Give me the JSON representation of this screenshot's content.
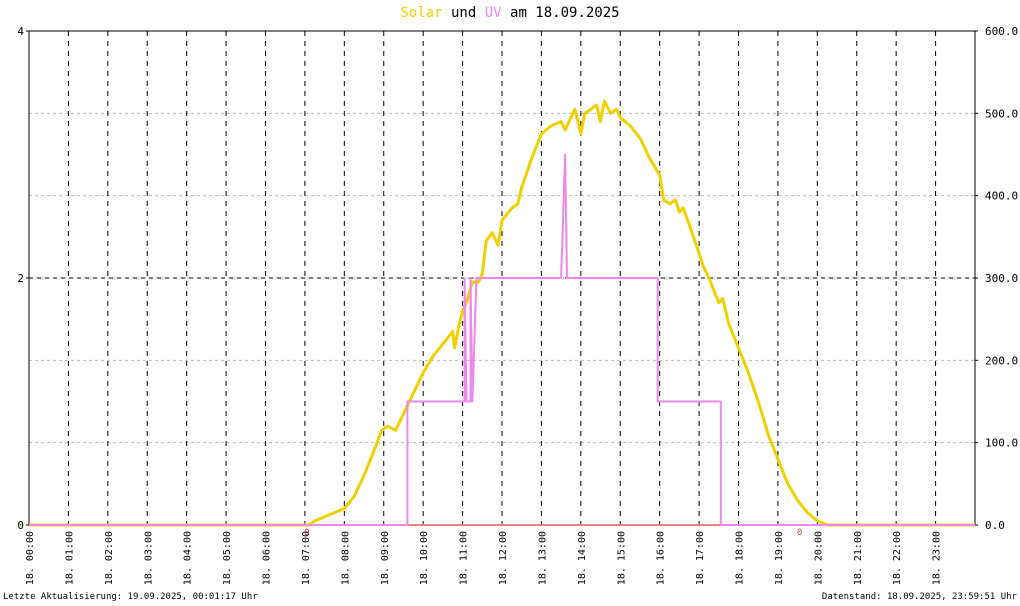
{
  "title": {
    "solar_word": "Solar",
    "und": "und",
    "uv_word": "UV",
    "am_date": "am 18.09.2025"
  },
  "colors": {
    "solar": "#f0d000",
    "uv": "#ee88ee",
    "zero_line": "#f08080",
    "frame": "#000000"
  },
  "footer": {
    "left": "Letzte Aktualisierung: 19.09.2025, 00:01:17 Uhr",
    "right": "Datenstand: 18.09.2025, 23:59:51 Uhr"
  },
  "chart_data": {
    "type": "line",
    "x_unit": "hour of day",
    "x_range": [
      0,
      24
    ],
    "x_tick_labels": [
      "18. 00:00",
      "18. 01:00",
      "18. 02:00",
      "18. 03:00",
      "18. 04:00",
      "18. 05:00",
      "18. 06:00",
      "18. 07:00",
      "18. 08:00",
      "18. 09:00",
      "18. 10:00",
      "18. 11:00",
      "18. 12:00",
      "18. 13:00",
      "18. 14:00",
      "18. 15:00",
      "18. 16:00",
      "18. 17:00",
      "18. 18:00",
      "18. 19:00",
      "18. 20:00",
      "18. 21:00",
      "18. 22:00",
      "18. 23:00"
    ],
    "y_left": {
      "range": [
        0,
        4
      ],
      "tick_labels": [
        "0",
        "2",
        "4"
      ]
    },
    "y_right": {
      "range": [
        0,
        600
      ],
      "tick_labels": [
        "0.0",
        "100.0",
        "200.0",
        "300.0",
        "400.0",
        "500.0",
        "600.0"
      ]
    },
    "grid": true,
    "zero_markers": [
      {
        "x": 7.05,
        "label": "0"
      },
      {
        "x": 19.55,
        "label": "0"
      }
    ],
    "series": [
      {
        "name": "Solar",
        "axis": "right",
        "points": [
          [
            0,
            0
          ],
          [
            7.1,
            0
          ],
          [
            7.25,
            5
          ],
          [
            7.5,
            10
          ],
          [
            7.75,
            15
          ],
          [
            8.0,
            20
          ],
          [
            8.25,
            35
          ],
          [
            8.5,
            60
          ],
          [
            8.75,
            90
          ],
          [
            8.95,
            115
          ],
          [
            9.1,
            120
          ],
          [
            9.3,
            115
          ],
          [
            9.5,
            135
          ],
          [
            9.75,
            160
          ],
          [
            10.0,
            185
          ],
          [
            10.25,
            205
          ],
          [
            10.5,
            220
          ],
          [
            10.75,
            235
          ],
          [
            10.8,
            215
          ],
          [
            10.9,
            240
          ],
          [
            11.0,
            260
          ],
          [
            11.1,
            270
          ],
          [
            11.25,
            295
          ],
          [
            11.4,
            295
          ],
          [
            11.5,
            305
          ],
          [
            11.6,
            345
          ],
          [
            11.75,
            355
          ],
          [
            11.9,
            340
          ],
          [
            12.0,
            370
          ],
          [
            12.25,
            385
          ],
          [
            12.4,
            390
          ],
          [
            12.5,
            410
          ],
          [
            12.75,
            445
          ],
          [
            13.0,
            475
          ],
          [
            13.25,
            485
          ],
          [
            13.5,
            490
          ],
          [
            13.6,
            480
          ],
          [
            13.75,
            495
          ],
          [
            13.85,
            505
          ],
          [
            14.0,
            475
          ],
          [
            14.1,
            500
          ],
          [
            14.25,
            505
          ],
          [
            14.4,
            510
          ],
          [
            14.5,
            490
          ],
          [
            14.6,
            515
          ],
          [
            14.75,
            500
          ],
          [
            14.9,
            505
          ],
          [
            15.0,
            495
          ],
          [
            15.25,
            485
          ],
          [
            15.5,
            470
          ],
          [
            15.75,
            445
          ],
          [
            16.0,
            425
          ],
          [
            16.1,
            395
          ],
          [
            16.25,
            390
          ],
          [
            16.4,
            395
          ],
          [
            16.5,
            380
          ],
          [
            16.6,
            385
          ],
          [
            16.75,
            365
          ],
          [
            17.0,
            330
          ],
          [
            17.1,
            315
          ],
          [
            17.25,
            300
          ],
          [
            17.5,
            270
          ],
          [
            17.6,
            275
          ],
          [
            17.75,
            245
          ],
          [
            18.0,
            215
          ],
          [
            18.25,
            185
          ],
          [
            18.5,
            150
          ],
          [
            18.6,
            135
          ],
          [
            18.75,
            110
          ],
          [
            19.0,
            80
          ],
          [
            19.25,
            50
          ],
          [
            19.5,
            30
          ],
          [
            19.75,
            15
          ],
          [
            20.0,
            5
          ],
          [
            20.25,
            0
          ],
          [
            24,
            0
          ]
        ]
      },
      {
        "name": "UV",
        "axis": "left",
        "points": [
          [
            0,
            0
          ],
          [
            9.6,
            0
          ],
          [
            9.6,
            1
          ],
          [
            11.05,
            1
          ],
          [
            11.05,
            2
          ],
          [
            11.1,
            1
          ],
          [
            11.2,
            1
          ],
          [
            11.2,
            2
          ],
          [
            11.25,
            1
          ],
          [
            11.3,
            1.5
          ],
          [
            11.35,
            2
          ],
          [
            13.5,
            2
          ],
          [
            13.55,
            2.5
          ],
          [
            13.6,
            3
          ],
          [
            13.65,
            2
          ],
          [
            14.0,
            2
          ],
          [
            15.95,
            2
          ],
          [
            15.95,
            1
          ],
          [
            17.55,
            1
          ],
          [
            17.55,
            0
          ],
          [
            24,
            0
          ]
        ]
      }
    ]
  }
}
